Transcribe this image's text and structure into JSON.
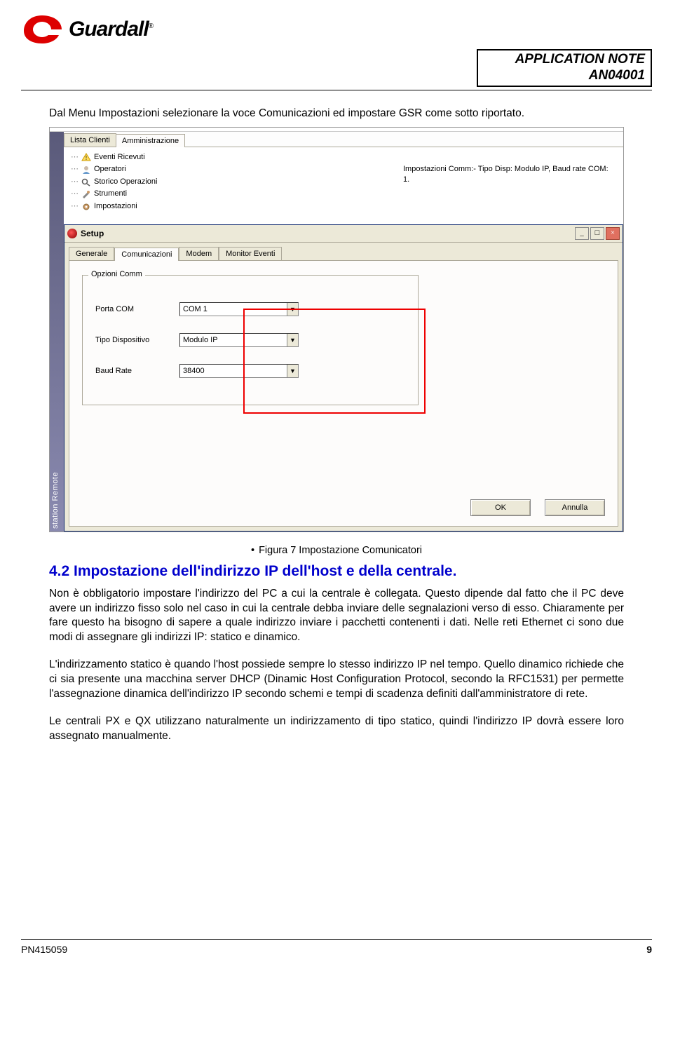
{
  "header": {
    "brand": "Guardall",
    "registered": "®",
    "note_line1": "APPLICATION NOTE",
    "note_line2": "AN04001"
  },
  "intro_text": "Dal Menu Impostazioni selezionare la voce Comunicazioni ed impostare GSR come sotto riportato.",
  "screenshot": {
    "side_ribbon": "station Remote",
    "outer_tabs": {
      "tab1": "Lista Clienti",
      "tab2": "Amministrazione"
    },
    "tree": {
      "item1": "Eventi Ricevuti",
      "item2": "Operatori",
      "item3": "Storico Operazioni",
      "item4": "Strumenti",
      "item5": "Impostazioni"
    },
    "status_text": "Impostazioni Comm:- Tipo Disp: Modulo IP, Baud rate COM: 1.",
    "setup": {
      "title": "Setup",
      "tabs": {
        "t1": "Generale",
        "t2": "Comunicazioni",
        "t3": "Modem",
        "t4": "Monitor Eventi"
      },
      "group_title": "Opzioni Comm",
      "rows": {
        "r1_label": "Porta COM",
        "r1_value": "COM 1",
        "r2_label": "Tipo Dispositivo",
        "r2_value": "Modulo IP",
        "r3_label": "Baud Rate",
        "r3_value": "38400"
      },
      "buttons": {
        "ok": "OK",
        "cancel": "Annulla"
      },
      "win_min": "_",
      "win_max": "□",
      "win_close": "×"
    }
  },
  "caption": "Figura 7 Impostazione Comunicatori",
  "section_title": "4.2 Impostazione dell'indirizzo IP dell'host e della centrale.",
  "para1": "Non è obbligatorio impostare l'indirizzo del PC a cui la centrale è collegata. Questo dipende dal fatto che il PC deve avere un indirizzo fisso solo nel caso in cui la centrale debba inviare delle segnalazioni verso di esso. Chiaramente per fare questo ha bisogno di sapere a quale indirizzo inviare i pacchetti contenenti i dati. Nelle reti Ethernet ci sono due modi di assegnare gli indirizzi IP: statico e dinamico.",
  "para2": "L'indirizzamento statico è quando l'host possiede sempre lo stesso indirizzo IP nel tempo. Quello dinamico richiede che ci sia presente una macchina server DHCP (Dinamic Host Configuration Protocol, secondo la RFC1531) per permette l'assegnazione dinamica dell'indirizzo IP secondo schemi e tempi di scadenza definiti dall'amministratore di rete.",
  "para3": "Le centrali PX e QX utilizzano naturalmente un indirizzamento di tipo statico, quindi l'indirizzo IP dovrà essere loro assegnato manualmente.",
  "footer": {
    "pn": "PN415059",
    "page": "9"
  }
}
